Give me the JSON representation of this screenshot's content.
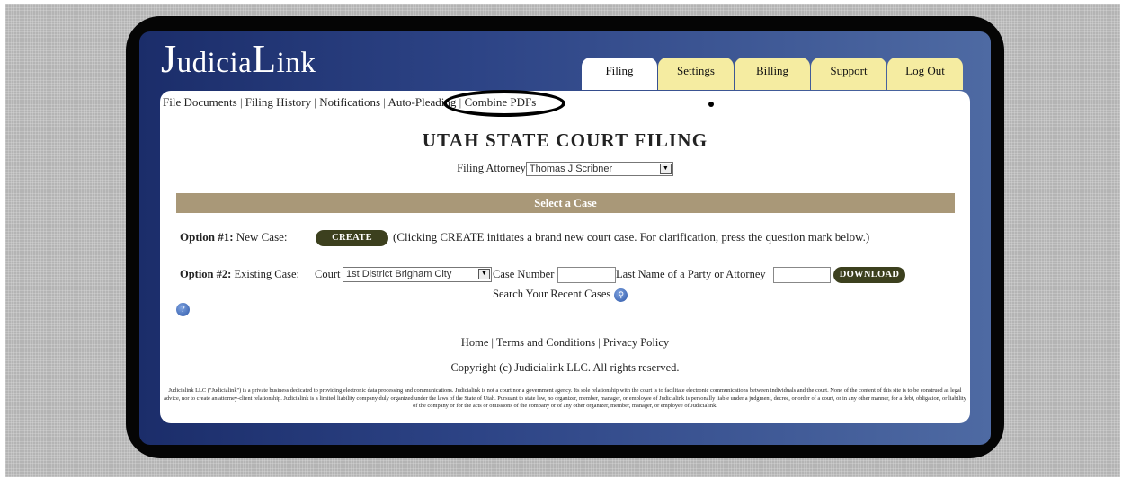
{
  "app": {
    "logo_first": "J",
    "logo_mid": "udicia",
    "logo_second": "L",
    "logo_end": "ink"
  },
  "tabs": [
    "Filing",
    "Settings",
    "Billing",
    "Support",
    "Log Out"
  ],
  "subnav": {
    "items": [
      "File Documents",
      "Filing History",
      "Notifications",
      "Auto-Pleading",
      "Combine PDFs"
    ],
    "separator": "|"
  },
  "main": {
    "title": "UTAH STATE COURT FILING",
    "attorney_label": "Filing Attorney",
    "attorney_value": "Thomas J Scribner",
    "select_case": "Select a Case",
    "option1_label": "Option #1:",
    "option1_text": "New Case:",
    "create_button": "CREATE",
    "option1_desc": "(Clicking CREATE initiates a brand new court case. For clarification, press the question mark below.)",
    "option2_label": "Option #2:",
    "option2_text": "Existing Case:",
    "court_label": "Court",
    "court_value": "1st District Brigham City",
    "case_number_label": "Case Number",
    "last_name_label": "Last Name of a Party or Attorney",
    "download_button": "DOWNLOAD",
    "recent_label": "Search Your Recent Cases"
  },
  "footer": {
    "links": [
      "Home",
      "Terms and Conditions",
      "Privacy Policy"
    ],
    "copyright": "Copyright (c) Judicialink LLC. All rights reserved.",
    "disclaimer": "Judicialink LLC (\"Judicialink\") is a private business dedicated to providing electronic data processing and communications. Judicialink is not a court nor a government agency. Its sole relationship with the court is to facilitate electronic communications between individuals and the court. None of the content of this site is to be construed as legal advice, nor to create an attorney-client relationship. Judicialink is a limited liability company duly organized under the laws of the State of Utah. Pursuant to state law, no organizer, member, manager, or employee of Judicialink is personally liable under a judgment, decree, or order of a court, or in any other manner, for a debt, obligation, or liability of the company or for the acts or omissions of the company or of any other organizer, member, manager, or employee of Judicialink."
  },
  "icons": {
    "help": "question-icon",
    "search": "magnifier-icon",
    "dropdown": "chevron-down-icon"
  },
  "colors": {
    "accent_bar": "#a99878",
    "button": "#3c401e",
    "tab": "#f5eca1",
    "panel": "#2d4486"
  }
}
